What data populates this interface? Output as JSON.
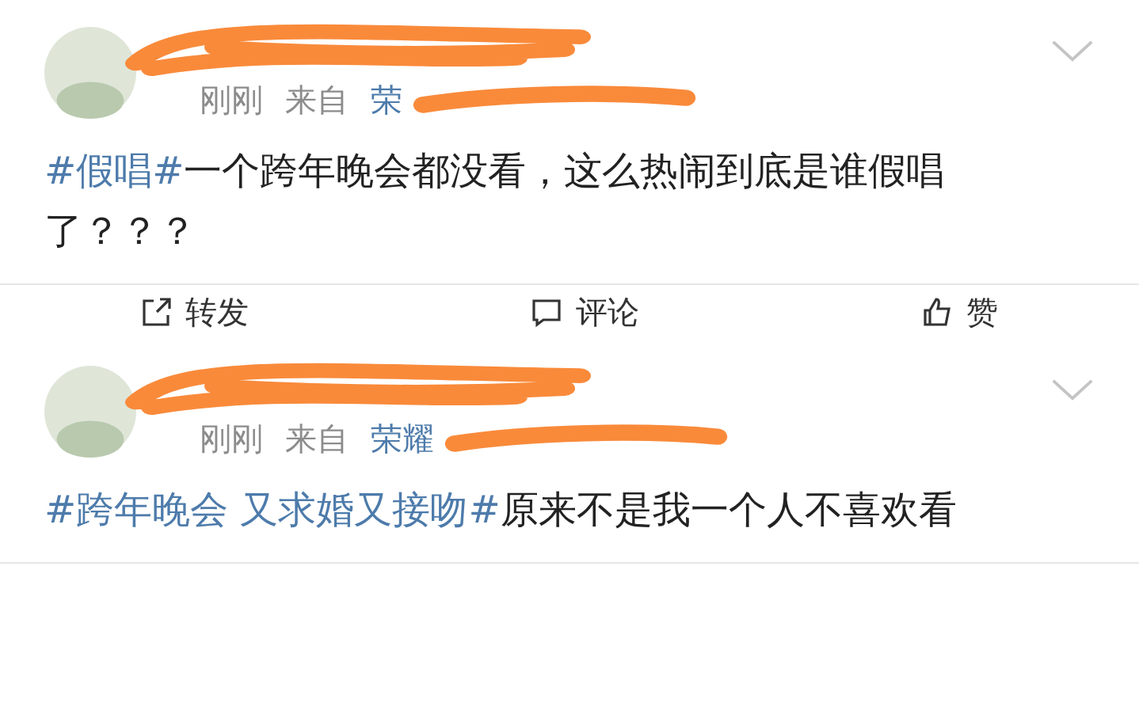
{
  "posts": [
    {
      "time": "刚刚",
      "source_prefix": "来自",
      "source": "荣",
      "body": [
        {
          "kind": "hashtag",
          "text": "#假唱#"
        },
        {
          "kind": "text",
          "text": "一个跨年晚会都没看，这么热闹到底是谁假唱了？？？"
        }
      ],
      "actions": [
        {
          "kind": "share",
          "label": "转发"
        },
        {
          "kind": "comment",
          "label": "评论"
        },
        {
          "kind": "like",
          "label": "赞"
        }
      ]
    },
    {
      "time": "刚刚",
      "source_prefix": "来自",
      "source": "荣耀",
      "body": [
        {
          "kind": "hashtag",
          "text": "#跨年晚会 又求婚又接吻#"
        },
        {
          "kind": "text",
          "text": "原来不是我一个人不喜欢看"
        }
      ]
    }
  ]
}
